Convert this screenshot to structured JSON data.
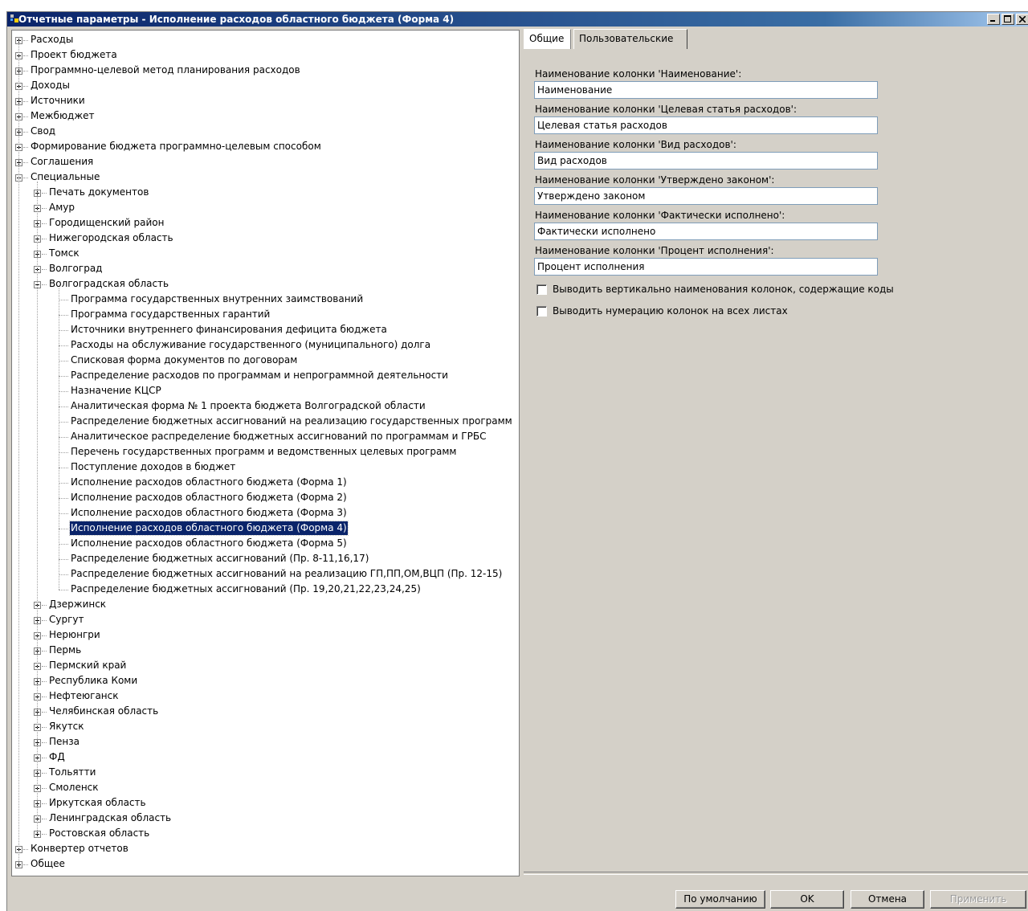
{
  "window": {
    "title": "Отчетные параметры - Исполнение расходов областного бюджета (Форма 4)",
    "buttons": [
      "minimize",
      "maximize",
      "close"
    ]
  },
  "tree": {
    "nodes": [
      {
        "label": "Расходы",
        "level": 0,
        "expander": "plus"
      },
      {
        "label": "Проект бюджета",
        "level": 0,
        "expander": "plus"
      },
      {
        "label": "Программно-целевой метод планирования расходов",
        "level": 0,
        "expander": "plus"
      },
      {
        "label": "Доходы",
        "level": 0,
        "expander": "plus"
      },
      {
        "label": "Источники",
        "level": 0,
        "expander": "plus"
      },
      {
        "label": "Межбюджет",
        "level": 0,
        "expander": "plus"
      },
      {
        "label": "Свод",
        "level": 0,
        "expander": "plus"
      },
      {
        "label": "Формирование бюджета программно-целевым способом",
        "level": 0,
        "expander": "plus"
      },
      {
        "label": "Соглашения",
        "level": 0,
        "expander": "plus"
      },
      {
        "label": "Специальные",
        "level": 0,
        "expander": "minus"
      },
      {
        "label": "Печать документов",
        "level": 1,
        "expander": "plus"
      },
      {
        "label": "Амур",
        "level": 1,
        "expander": "plus"
      },
      {
        "label": "Городищенский район",
        "level": 1,
        "expander": "plus"
      },
      {
        "label": "Нижегородская область",
        "level": 1,
        "expander": "plus"
      },
      {
        "label": "Томск",
        "level": 1,
        "expander": "plus"
      },
      {
        "label": "Волгоград",
        "level": 1,
        "expander": "plus"
      },
      {
        "label": "Волгоградская область",
        "level": 1,
        "expander": "minus"
      },
      {
        "label": "Программа государственных внутренних заимствований",
        "level": 2,
        "expander": "none"
      },
      {
        "label": "Программа государственных гарантий",
        "level": 2,
        "expander": "none"
      },
      {
        "label": "Источники внутреннего финансирования дефицита бюджета",
        "level": 2,
        "expander": "none"
      },
      {
        "label": "Расходы на обслуживание государственного (муниципального) долга",
        "level": 2,
        "expander": "none"
      },
      {
        "label": "Списковая форма документов по договорам",
        "level": 2,
        "expander": "none"
      },
      {
        "label": "Распределение расходов по программам и непрограммной деятельности",
        "level": 2,
        "expander": "none"
      },
      {
        "label": "Назначение КЦСР",
        "level": 2,
        "expander": "none"
      },
      {
        "label": "Аналитическая форма № 1 проекта бюджета Волгоградской области",
        "level": 2,
        "expander": "none"
      },
      {
        "label": "Распределение бюджетных ассигнований на реализацию государственных программ",
        "level": 2,
        "expander": "none"
      },
      {
        "label": "Аналитическое распределение бюджетных ассигнований по программам и ГРБС",
        "level": 2,
        "expander": "none"
      },
      {
        "label": "Перечень государственных программ и ведомственных целевых программ",
        "level": 2,
        "expander": "none"
      },
      {
        "label": "Поступление доходов в бюджет",
        "level": 2,
        "expander": "none"
      },
      {
        "label": "Исполнение расходов областного бюджета (Форма 1)",
        "level": 2,
        "expander": "none"
      },
      {
        "label": "Исполнение расходов областного бюджета (Форма 2)",
        "level": 2,
        "expander": "none"
      },
      {
        "label": "Исполнение расходов областного бюджета (Форма 3)",
        "level": 2,
        "expander": "none"
      },
      {
        "label": "Исполнение расходов областного бюджета (Форма 4)",
        "level": 2,
        "expander": "none",
        "selected": true
      },
      {
        "label": "Исполнение расходов областного бюджета (Форма 5)",
        "level": 2,
        "expander": "none"
      },
      {
        "label": "Распределение бюджетных ассигнований (Пр. 8-11,16,17)",
        "level": 2,
        "expander": "none"
      },
      {
        "label": "Распределение бюджетных ассигнований на реализацию ГП,ПП,ОМ,ВЦП (Пр. 12-15)",
        "level": 2,
        "expander": "none"
      },
      {
        "label": "Распределение бюджетных ассигнований (Пр. 19,20,21,22,23,24,25)",
        "level": 2,
        "expander": "none",
        "last": true
      },
      {
        "label": "Дзержинск",
        "level": 1,
        "expander": "plus"
      },
      {
        "label": "Сургут",
        "level": 1,
        "expander": "plus"
      },
      {
        "label": "Нерюнгри",
        "level": 1,
        "expander": "plus"
      },
      {
        "label": "Пермь",
        "level": 1,
        "expander": "plus"
      },
      {
        "label": "Пермский край",
        "level": 1,
        "expander": "plus"
      },
      {
        "label": "Республика Коми",
        "level": 1,
        "expander": "plus"
      },
      {
        "label": "Нефтеюганск",
        "level": 1,
        "expander": "plus"
      },
      {
        "label": "Челябинская область",
        "level": 1,
        "expander": "plus"
      },
      {
        "label": "Якутск",
        "level": 1,
        "expander": "plus"
      },
      {
        "label": "Пенза",
        "level": 1,
        "expander": "plus"
      },
      {
        "label": "ФД",
        "level": 1,
        "expander": "plus"
      },
      {
        "label": "Тольятти",
        "level": 1,
        "expander": "plus"
      },
      {
        "label": "Смоленск",
        "level": 1,
        "expander": "plus"
      },
      {
        "label": "Иркутская область",
        "level": 1,
        "expander": "plus"
      },
      {
        "label": "Ленинградская область",
        "level": 1,
        "expander": "plus"
      },
      {
        "label": "Ростовская область",
        "level": 1,
        "expander": "plus",
        "last": true
      },
      {
        "label": "Конвертер отчетов",
        "level": 0,
        "expander": "plus"
      },
      {
        "label": "Общее",
        "level": 0,
        "expander": "plus",
        "last": true
      }
    ]
  },
  "tabs": {
    "general": "Общие",
    "custom": "Пользовательские"
  },
  "form": {
    "fields": [
      {
        "label": "Наименование колонки 'Наименование':",
        "value": "Наименование"
      },
      {
        "label": "Наименование колонки 'Целевая статья расходов':",
        "value": "Целевая статья расходов"
      },
      {
        "label": "Наименование колонки 'Вид расходов':",
        "value": "Вид расходов"
      },
      {
        "label": "Наименование колонки 'Утверждено законом':",
        "value": "Утверждено законом"
      },
      {
        "label": "Наименование колонки 'Фактически исполнено':",
        "value": "Фактически исполнено"
      },
      {
        "label": "Наименование колонки 'Процент исполнения':",
        "value": "Процент исполнения"
      }
    ],
    "checkboxes": [
      {
        "label": "Выводить вертикально наименования колонок, содержащие коды",
        "checked": false
      },
      {
        "label": "Выводить нумерацию колонок на всех листах",
        "checked": false
      }
    ]
  },
  "buttons": {
    "default": "По умолчанию",
    "ok": "OK",
    "cancel": "Отмена",
    "apply": "Применить"
  },
  "colors": {
    "title_bar": "#0a246a",
    "selection": "#0a246a",
    "face": "#d4d0c8"
  }
}
